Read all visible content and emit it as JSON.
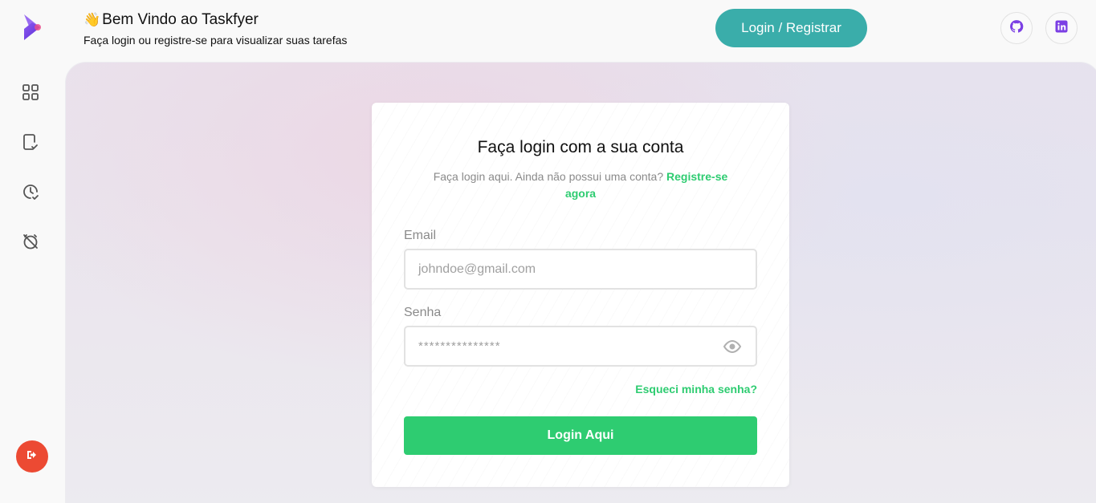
{
  "header": {
    "wave_emoji": "👋",
    "title": "Bem Vindo ao Taskfyer",
    "subtitle": "Faça login ou registre-se para visualizar suas tarefas",
    "login_register_label": "Login / Registrar",
    "social_icons": [
      "github-icon",
      "linkedin-icon"
    ]
  },
  "sidebar": {
    "items": [
      "grid-icon",
      "task-check-icon",
      "history-icon",
      "timer-off-icon"
    ],
    "logout_icon": "logout-icon"
  },
  "colors": {
    "teal_accent": "#3aadaa",
    "green_accent": "#2ecc71",
    "logout_red": "#ec4a33",
    "logo_purple": "#7b3fe4"
  },
  "login_card": {
    "title": "Faça login com a sua conta",
    "subtitle_text": "Faça login aqui. Ainda não possui uma conta?",
    "register_link": "Registre-se agora",
    "email_label": "Email",
    "email_placeholder": "johndoe@gmail.com",
    "password_label": "Senha",
    "password_value": "***************",
    "forgot_password": "Esqueci minha senha?",
    "submit_label": "Login Aqui"
  }
}
